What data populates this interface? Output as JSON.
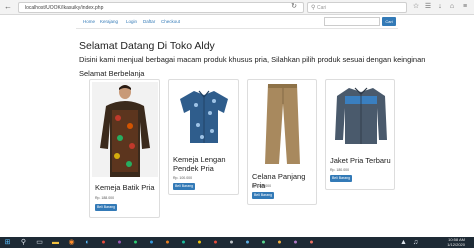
{
  "browser": {
    "url": "localhost/UOOK/Ikasuiky/index.php",
    "search_placeholder": "Cari"
  },
  "site_nav": {
    "links": [
      "Home",
      "Kerajang",
      "Login",
      "Daftar",
      "Checkout"
    ],
    "search_placeholder": "",
    "search_button": "Cari"
  },
  "content": {
    "heading": "Selamat Datang Di Toko Aldy",
    "intro": "Disini kami menjual berbagai macam produk khusus pria, Silahkan pilih produk sesuai dengan keinginan",
    "subheading": "Selamat Berbelanja"
  },
  "products": [
    {
      "title": "Kemeja Batik Pria",
      "price": "Rp. 188.000",
      "button": "Beli Barang"
    },
    {
      "title": "Kemeja Lengan Pendek Pria",
      "price": "Rp. 100.000",
      "button": "Beli Barang"
    },
    {
      "title": "Celana Panjang Pria",
      "price": "Rp. 155.000",
      "button": "Beli Barang"
    },
    {
      "title": "Jaket Pria Terbaru",
      "price": "Rp. 180.000",
      "button": "Beli Barang"
    }
  ],
  "taskbar": {
    "time": "10:58 AM",
    "date": "1/12/2020"
  },
  "colors": {
    "accent": "#337ab7",
    "taskbar": "#1e2a35"
  }
}
